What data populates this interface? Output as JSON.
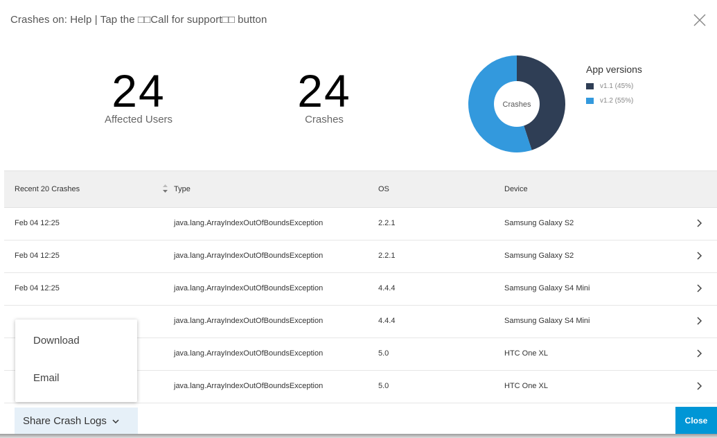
{
  "header": {
    "title": "Crashes on: Help | Tap the □□Call for support□□ button",
    "close_icon": "close-icon"
  },
  "metrics": {
    "affected_users": {
      "value": "24",
      "label": "Affected Users"
    },
    "crashes": {
      "value": "24",
      "label": "Crashes"
    }
  },
  "donut": {
    "center_label": "Crashes",
    "legend_title": "App versions",
    "slices": [
      {
        "name": "v1.1 (45%)",
        "percent": 45,
        "color": "#2f3e55"
      },
      {
        "name": "v1.2 (55%)",
        "percent": 55,
        "color": "#3399dd"
      }
    ]
  },
  "table": {
    "headers": {
      "date": "Recent 20 Crashes",
      "type": "Type",
      "os": "OS",
      "device": "Device"
    },
    "rows": [
      {
        "date": "Feb 04 12:25",
        "type": "java.lang.ArrayIndexOutOfBoundsException",
        "os": "2.2.1",
        "device": "Samsung Galaxy S2"
      },
      {
        "date": "Feb 04 12:25",
        "type": "java.lang.ArrayIndexOutOfBoundsException",
        "os": "2.2.1",
        "device": "Samsung Galaxy S2"
      },
      {
        "date": "Feb 04 12:25",
        "type": "java.lang.ArrayIndexOutOfBoundsException",
        "os": "4.4.4",
        "device": "Samsung Galaxy S4 Mini"
      },
      {
        "date": "",
        "type": "java.lang.ArrayIndexOutOfBoundsException",
        "os": "4.4.4",
        "device": "Samsung Galaxy S4 Mini"
      },
      {
        "date": "",
        "type": "java.lang.ArrayIndexOutOfBoundsException",
        "os": "5.0",
        "device": "HTC One XL"
      },
      {
        "date": "",
        "type": "java.lang.ArrayIndexOutOfBoundsException",
        "os": "5.0",
        "device": "HTC One XL"
      }
    ]
  },
  "share_menu": {
    "items": [
      "Download",
      "Email"
    ]
  },
  "footer": {
    "share_label": "Share Crash Logs",
    "close_label": "Close"
  },
  "colors": {
    "primary_button": "#0096d6",
    "share_button_bg": "#e6f0f8"
  }
}
